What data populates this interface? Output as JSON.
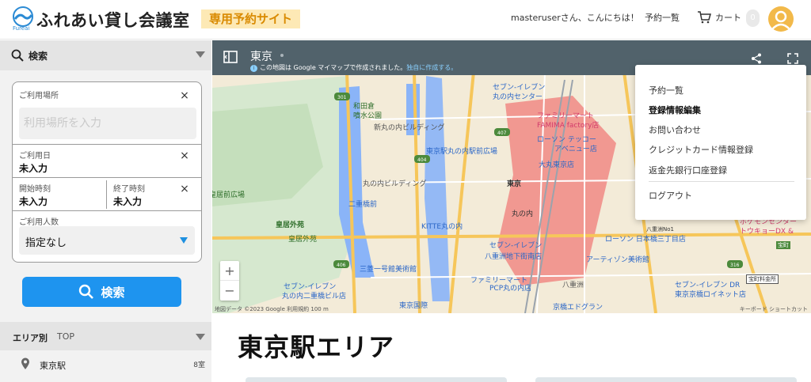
{
  "header": {
    "logo_sub": "Fureai",
    "brand": "ふれあい貸し会議室",
    "badge": "専用予約サイト",
    "greeting": "masteruserさん、こんにちは！",
    "nav_reservations": "予約一覧",
    "cart_label": "カート",
    "cart_count": "0"
  },
  "sidebar": {
    "search_title": "検索",
    "place_label": "ご利用場所",
    "place_placeholder": "利用場所を入力",
    "date_label": "ご利用日",
    "date_value": "未入力",
    "start_label": "開始時刻",
    "start_value": "未入力",
    "end_label": "終了時刻",
    "end_value": "未入力",
    "people_label": "ご利用人数",
    "people_value": "指定なし",
    "search_button": "検索",
    "area_title": "エリア別",
    "area_top": "TOP",
    "area_items": [
      {
        "name": "東京駅",
        "count": "8室"
      }
    ]
  },
  "map": {
    "title": "東京",
    "subtitle": "この地図は Google マイマップで作成されました。",
    "subtitle_link": "独自に作成する。",
    "zoom_in": "+",
    "zoom_out": "−",
    "attribution": "地図データ ©2023 Google   利用規約   100 m",
    "shortcut": "キーボード ショートカット",
    "labels": {
      "l1": "和田倉",
      "l2": "噴水公園",
      "l3": "新丸の内ビルディング",
      "l4": "皇居前広場",
      "l5": "丸の内ビルディング",
      "l6": "皇居外苑",
      "l7": "皇居外苑",
      "l8": "二重橋前",
      "l9": "KITTE丸の内",
      "l10": "三菱一号館美術館",
      "l11": "セブン-イレブン",
      "l12": "丸の内二重橋ビル店",
      "l13": "東京駅丸の内駅前広場",
      "l14": "東京",
      "l15": "丸の内",
      "l16": "セブン-イレブン",
      "l17": "八重洲地下街南店",
      "l18": "ファミリーマート",
      "l19": "PCP丸の内店",
      "l20": "八重洲",
      "l21": "東京国際",
      "l22": "セブン-イレブン",
      "l23": "丸の内センター",
      "l24": "ファミリーマート",
      "l25": "FAMIMA factory店",
      "l26": "ローソン テッコー",
      "l27": "アベニュー店",
      "l28": "大丸東京店",
      "l29": "アーティゾン美術館",
      "l30": "京橋エドグラン",
      "l31": "ローソン 日本橋三丁目店",
      "l32": "ポケモンセンター",
      "l33": "トウキョーDX &",
      "l34": "セブン-イレブン DR",
      "l35": "東京京橋ロイネット店",
      "l36": "宝町料金所",
      "l37": "八重洲No1",
      "l38": "宝町"
    },
    "road_numbers": [
      "301",
      "407",
      "404",
      "406",
      "316"
    ]
  },
  "menu": {
    "items": [
      "予約一覧",
      "登録情報編集",
      "お問い合わせ",
      "クレジットカード情報登録",
      "返金先銀行口座登録",
      "ログアウト"
    ]
  },
  "main": {
    "heading": "東京駅エリア"
  }
}
